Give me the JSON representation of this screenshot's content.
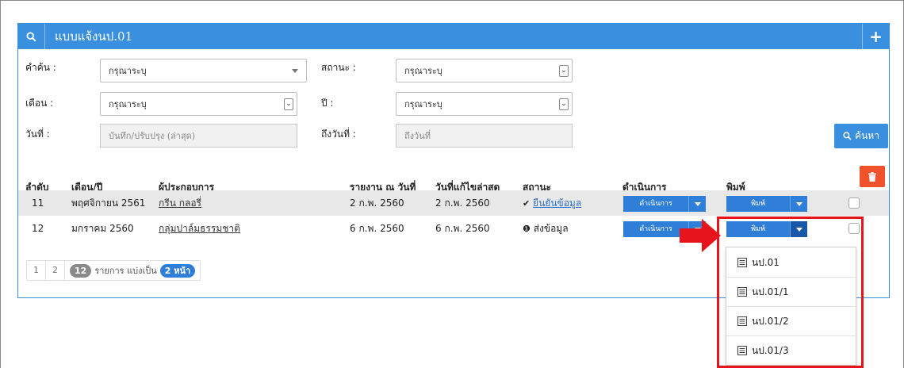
{
  "panel": {
    "title": "แบบแจ้งนป.01",
    "search_icon": "search-icon",
    "add_icon": "plus-icon",
    "add_label": "+"
  },
  "filters": {
    "keyword_label": "คำค้น :",
    "keyword_value": "กรุณาระบุ",
    "status_label": "สถานะ :",
    "status_value": "กรุณาระบุ",
    "month_label": "เดือน :",
    "month_value": "กรุณาระบุ",
    "year_label": "ปี :",
    "year_value": "กรุณาระบุ",
    "date_label": "วันที่ :",
    "date_placeholder": "บันทึก/ปรับปรุง (ล่าสุด)",
    "to_date_label": "ถึงวันที่ :",
    "to_date_placeholder": "ถึงวันที่",
    "search_button": "ค้นหา"
  },
  "table": {
    "headers": [
      "ลำดับ",
      "เดือน/ปี",
      "ผู้ประกอบการ",
      "รายงาน ณ วันที่",
      "วันที่แก้ไขล่าสุด",
      "สถานะ",
      "ดำเนินการ",
      "พิมพ์"
    ],
    "rows": [
      {
        "no": "11",
        "month": "พฤศจิกายน 2561",
        "operator": "กรีน กลอรี่",
        "report_date": "2 ก.พ. 2560",
        "edited": "2 ก.พ. 2560",
        "status_icon": "check-icon",
        "status_glyph": "✔",
        "status": "ยืนยันข้อมูล",
        "action": "ดำเนินการ",
        "print": "พิมพ์"
      },
      {
        "no": "12",
        "month": "มกราคม 2560",
        "operator": "กลุ่มปาล์มธรรมชาติ",
        "report_date": "6 ก.พ. 2560",
        "edited": "6 ก.พ. 2560",
        "status_icon": "info-icon",
        "status_glyph": "❶",
        "status": "ส่งข้อมูล",
        "action": "ดำเนินการ",
        "print": "พิมพ์"
      }
    ]
  },
  "pager": {
    "pages": [
      "1",
      "2"
    ],
    "total": "12",
    "text": "รายการ แบ่งเป็น",
    "pages_badge": "2 หน้า"
  },
  "print_menu": {
    "items": [
      "นป.01",
      "นป.01/1",
      "นป.01/2",
      "นป.01/3"
    ]
  },
  "colors": {
    "primary": "#3a8fde",
    "danger": "#f0522c",
    "highlight": "#e8141c"
  }
}
